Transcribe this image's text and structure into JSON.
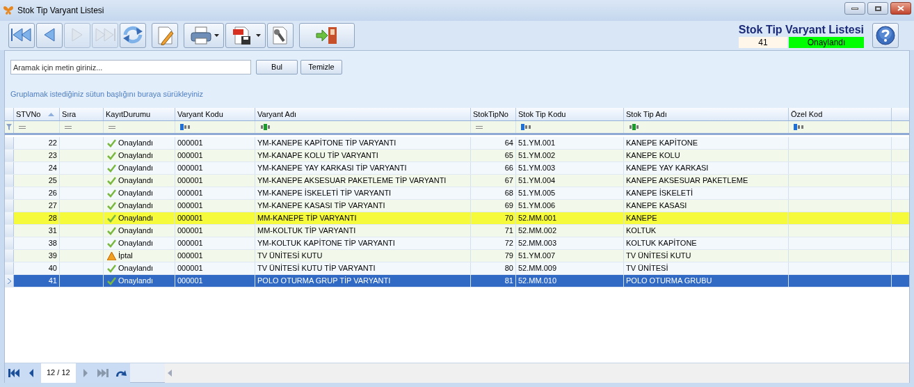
{
  "window": {
    "title": "Stok Tip Varyant Listesi"
  },
  "toolbar": [
    {
      "kind": "first",
      "disabled": false
    },
    {
      "kind": "prev",
      "disabled": false
    },
    {
      "kind": "next",
      "disabled": true
    },
    {
      "kind": "last",
      "disabled": true
    },
    {
      "kind": "refresh",
      "disabled": false
    },
    {
      "kind": "edit",
      "disabled": false
    },
    {
      "kind": "print",
      "disabled": false
    },
    {
      "kind": "pdf",
      "disabled": false
    },
    {
      "kind": "tools",
      "disabled": false
    },
    {
      "kind": "exit",
      "disabled": false
    }
  ],
  "header": {
    "title": "Stok Tip Varyant Listesi",
    "record_no": "41",
    "status": "Onaylandı"
  },
  "search": {
    "placeholder": "Aramak için metin giriniz...",
    "buttons": [
      "Bul",
      "Temizle"
    ]
  },
  "group_hint": "Gruplamak istediğiniz sütun başlığını buraya sürükleyiniz",
  "table": {
    "columns": [
      {
        "label": "STVNo",
        "kind": "equals",
        "sorted": true
      },
      {
        "label": "Sıra",
        "kind": "equals",
        "sorted": false
      },
      {
        "label": "KayıtDurumu",
        "kind": "equals",
        "sorted": false
      },
      {
        "label": "Varyant Kodu",
        "kind": "begins",
        "sorted": false
      },
      {
        "label": "Varyant Adı",
        "kind": "contains",
        "sorted": false
      },
      {
        "label": "StokTipNo",
        "kind": "equals",
        "sorted": false
      },
      {
        "label": "Stok Tip Kodu",
        "kind": "begins",
        "sorted": false
      },
      {
        "label": "Stok Tip Adı",
        "kind": "contains",
        "sorted": false
      },
      {
        "label": "Özel Kod",
        "kind": "begins",
        "sorted": false
      }
    ],
    "rows": [
      {
        "stvno": "22",
        "status": {
          "kind": "approved",
          "label": "Onaylandı"
        },
        "code": "000001",
        "name": "YM-KANEPE KAPİTONE TİP VARYANTI",
        "type_no": "64",
        "type_code": "51.YM.001",
        "type_name": "KANEPE KAPİTONE",
        "highlighted": false,
        "selected": false
      },
      {
        "stvno": "23",
        "status": {
          "kind": "approved",
          "label": "Onaylandı"
        },
        "code": "000001",
        "name": "YM-KANAPE KOLU TİP VARYANTI",
        "type_no": "65",
        "type_code": "51.YM.002",
        "type_name": "KANEPE KOLU",
        "highlighted": false,
        "selected": false
      },
      {
        "stvno": "24",
        "status": {
          "kind": "approved",
          "label": "Onaylandı"
        },
        "code": "000001",
        "name": "YM-KANEPE YAY KARKASI TİP VARYANTI",
        "type_no": "66",
        "type_code": "51.YM.003",
        "type_name": "KANEPE YAY KARKASI",
        "highlighted": false,
        "selected": false
      },
      {
        "stvno": "25",
        "status": {
          "kind": "approved",
          "label": "Onaylandı"
        },
        "code": "000001",
        "name": "YM-KANEPE AKSESUAR PAKETLEME TİP VARYANTI",
        "type_no": "67",
        "type_code": "51.YM.004",
        "type_name": "KANEPE AKSESUAR PAKETLEME",
        "highlighted": false,
        "selected": false
      },
      {
        "stvno": "26",
        "status": {
          "kind": "approved",
          "label": "Onaylandı"
        },
        "code": "000001",
        "name": "YM-KANEPE İSKELETİ TİP VARYANTI",
        "type_no": "68",
        "type_code": "51.YM.005",
        "type_name": "KANEPE İSKELETİ",
        "highlighted": false,
        "selected": false
      },
      {
        "stvno": "27",
        "status": {
          "kind": "approved",
          "label": "Onaylandı"
        },
        "code": "000001",
        "name": "YM-KANEPE KASASI TİP VARYANTI",
        "type_no": "69",
        "type_code": "51.YM.006",
        "type_name": "KANEPE KASASI",
        "highlighted": false,
        "selected": false
      },
      {
        "stvno": "28",
        "status": {
          "kind": "approved",
          "label": "Onaylandı"
        },
        "code": "000001",
        "name": "MM-KANEPE TİP VARYANTI",
        "type_no": "70",
        "type_code": "52.MM.001",
        "type_name": "KANEPE",
        "highlighted": true,
        "selected": false
      },
      {
        "stvno": "31",
        "status": {
          "kind": "approved",
          "label": "Onaylandı"
        },
        "code": "000001",
        "name": "MM-KOLTUK TİP VARYANTI",
        "type_no": "71",
        "type_code": "52.MM.002",
        "type_name": "KOLTUK",
        "highlighted": false,
        "selected": false
      },
      {
        "stvno": "38",
        "status": {
          "kind": "approved",
          "label": "Onaylandı"
        },
        "code": "000001",
        "name": "YM-KOLTUK KAPİTONE TİP VARYANTI",
        "type_no": "72",
        "type_code": "52.MM.003",
        "type_name": "KOLTUK KAPİTONE",
        "highlighted": false,
        "selected": false
      },
      {
        "stvno": "39",
        "status": {
          "kind": "cancelled",
          "label": "İptal"
        },
        "code": "000001",
        "name": "TV ÜNİTESİ KUTU",
        "type_no": "79",
        "type_code": "51.YM.007",
        "type_name": "TV ÜNİTESİ KUTU",
        "highlighted": false,
        "selected": false
      },
      {
        "stvno": "40",
        "status": {
          "kind": "approved",
          "label": "Onaylandı"
        },
        "code": "000001",
        "name": "TV ÜNİTESİ KUTU TİP VARYANTI",
        "type_no": "80",
        "type_code": "52.MM.009",
        "type_name": "TV ÜNİTESİ",
        "highlighted": false,
        "selected": false
      },
      {
        "stvno": "41",
        "status": {
          "kind": "approved",
          "label": "Onaylandı"
        },
        "code": "000001",
        "name": "POLO OTURMA GRUP TİP VARYANTI",
        "type_no": "81",
        "type_code": "52.MM.010",
        "type_name": "POLO OTURMA GRUBU",
        "highlighted": false,
        "selected": true
      }
    ]
  },
  "pager": {
    "position": "12 / 12"
  }
}
